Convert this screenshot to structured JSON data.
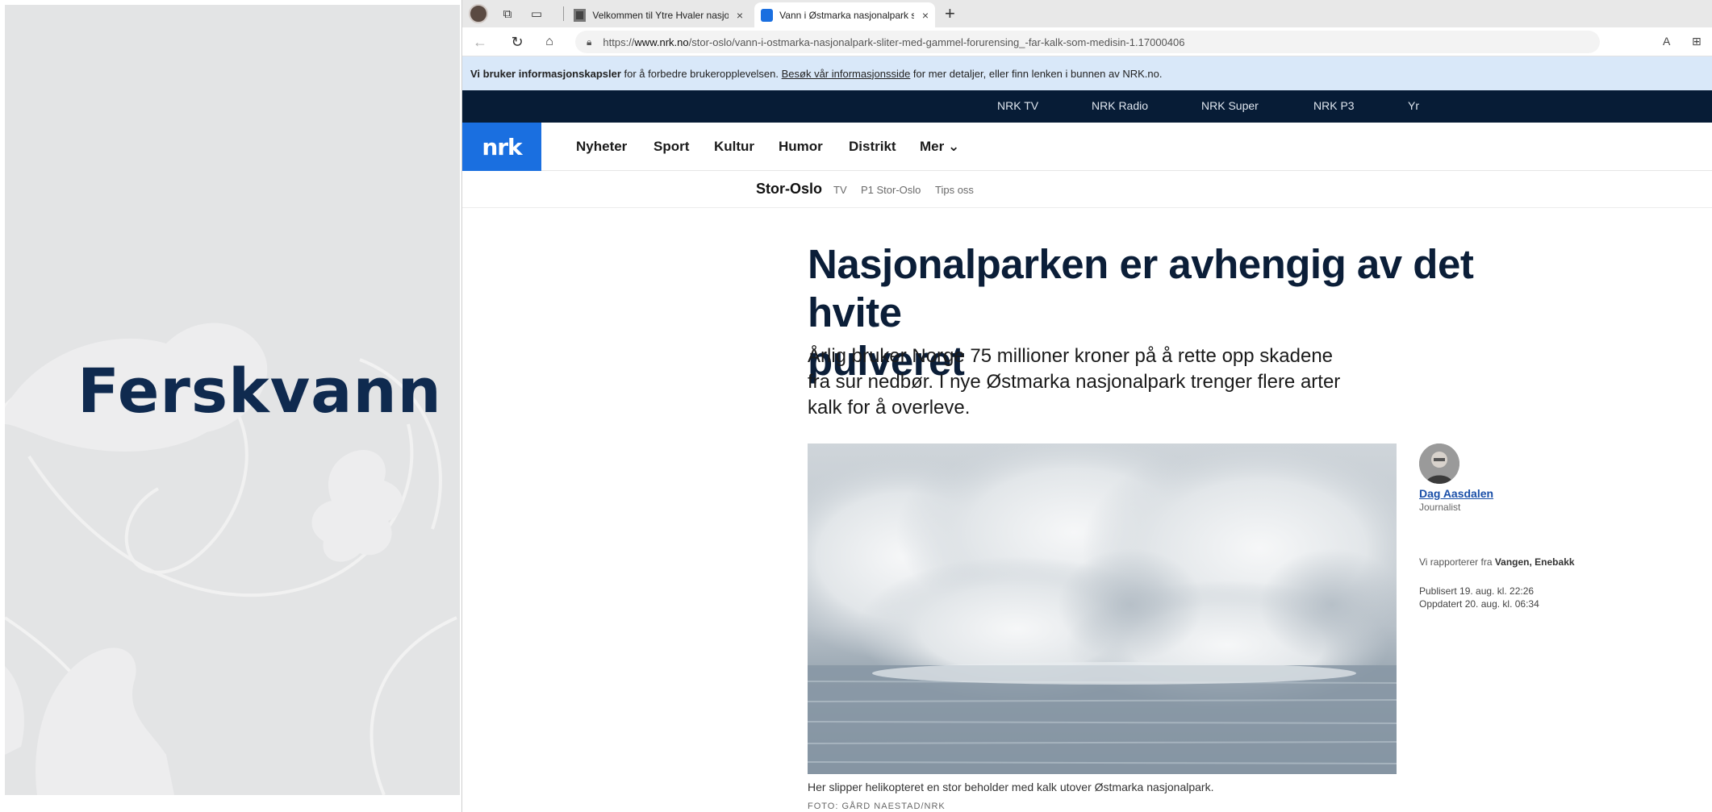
{
  "slide": {
    "title": "Ferskvann"
  },
  "browser": {
    "tabs": [
      {
        "label": "Velkommen til Ytre Hvaler nasjon",
        "close": "×"
      },
      {
        "label": "Vann i Østmarka nasjonalpark slit",
        "close": "×"
      }
    ],
    "new_tab": "+",
    "url_prefix": "https://",
    "url_host": "www.nrk.no",
    "url_path": "/stor-oslo/vann-i-ostmarka-nasjonalpark-sliter-med-gammel-forurensing_-far-kalk-som-medisin-1.17000406"
  },
  "cookie_banner": {
    "bold": "Vi bruker informasjonskapsler",
    "text1": " for å forbedre brukeropplevelsen. ",
    "link": "Besøk vår informasjonsside",
    "text2": " for mer detaljer, eller finn lenken i bunnen av NRK.no."
  },
  "top_links": [
    "NRK TV",
    "NRK Radio",
    "NRK Super",
    "NRK P3",
    "Yr"
  ],
  "main_nav": {
    "logo": "nrk",
    "items": [
      "Nyheter",
      "Sport",
      "Kultur",
      "Humor",
      "Distrikt",
      "Mer ⌄"
    ]
  },
  "sub_nav": {
    "section": "Stor-Oslo",
    "links": [
      "TV",
      "P1 Stor-Oslo",
      "Tips oss"
    ]
  },
  "article": {
    "headline_line1": "Nasjonalparken er avhengig av det hvite",
    "headline_line2": "pulveret",
    "lede": "Årlig bruker Norge 75 millioner kroner på å rette opp skadene fra sur nedbør. I nye Østmarka nasjonalpark trenger flere arter kalk for å overleve.",
    "caption": "Her slipper helikopteret en stor beholder med kalk utover Østmarka nasjonalpark.",
    "credit": "FOTO: GÅRD NAESTAD/NRK"
  },
  "byline": {
    "name": "Dag Aasdalen",
    "role": "Journalist",
    "reporting_prefix": "Vi rapporterer fra ",
    "reporting_place": "Vangen, Enebakk",
    "published": "Publisert 19. aug. kl. 22:26",
    "updated": "Oppdatert 20. aug. kl. 06:34"
  },
  "colors": {
    "nrk_blue": "#1a6fe0",
    "topbar": "#071c36",
    "cookie": "#d9e8f9",
    "headline": "#0b1e38",
    "slide_title": "#0f2a4f"
  }
}
